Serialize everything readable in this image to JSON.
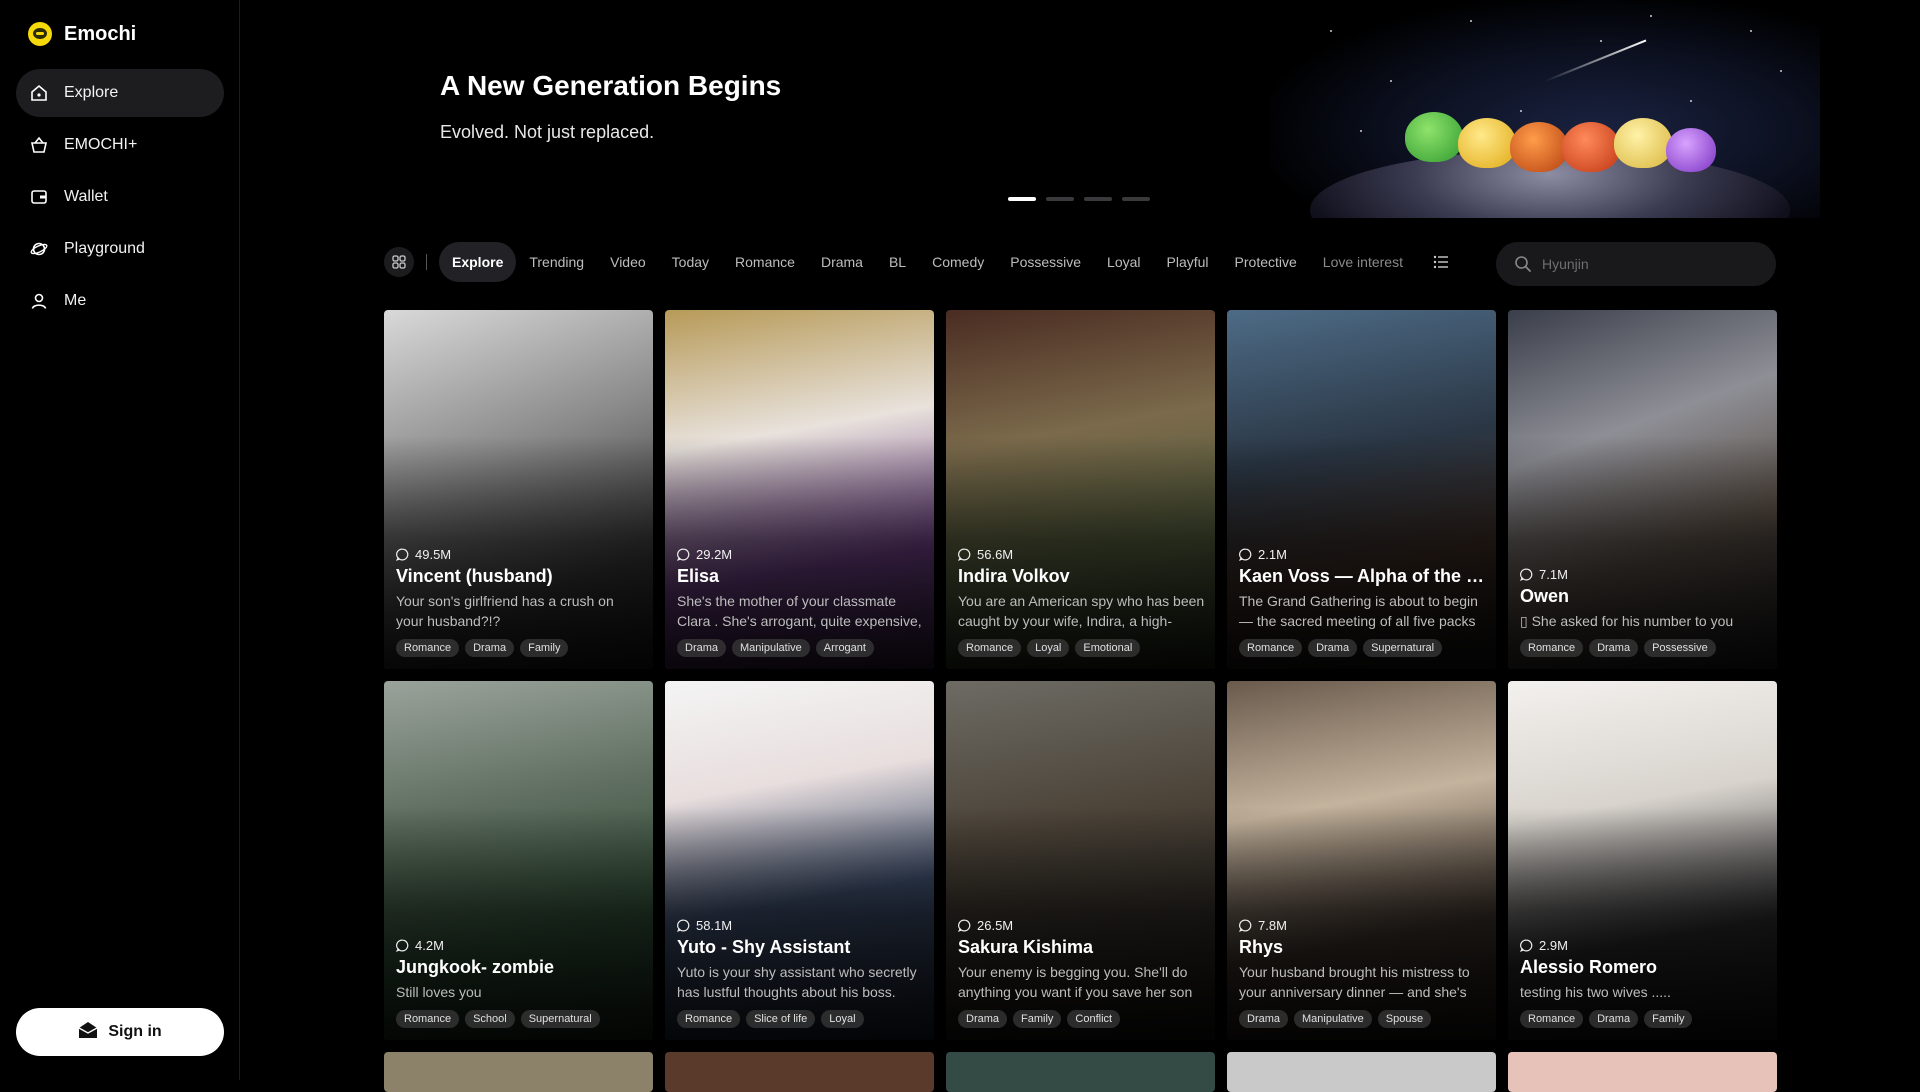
{
  "app": {
    "name": "Emochi"
  },
  "sidebar": {
    "items": [
      {
        "label": "Explore",
        "icon": "home-icon",
        "active": true
      },
      {
        "label": "EMOCHI+",
        "icon": "basket-icon",
        "active": false
      },
      {
        "label": "Wallet",
        "icon": "wallet-icon",
        "active": false
      },
      {
        "label": "Playground",
        "icon": "planet-icon",
        "active": false
      },
      {
        "label": "Me",
        "icon": "user-icon",
        "active": false
      }
    ],
    "signin_label": "Sign in"
  },
  "banner": {
    "title": "A New Generation Begins",
    "subtitle": "Evolved. Not just replaced.",
    "slides": 4,
    "active_slide": 1
  },
  "tabs": {
    "items": [
      "Explore",
      "Trending",
      "Video",
      "Today",
      "Romance",
      "Drama",
      "BL",
      "Comedy",
      "Possessive",
      "Loyal",
      "Playful",
      "Protective",
      "Love interest"
    ],
    "active": "Explore"
  },
  "search": {
    "placeholder": "Hyunjin"
  },
  "cards": [
    {
      "count": "49.5M",
      "name": "Vincent (husband)",
      "desc": "Your son's girlfriend has a crush on your husband?!?",
      "tags": [
        "Romance",
        "Drama",
        "Family"
      ],
      "bg": "linear-gradient(160deg,#d9d9d9 0%,#8a8a8a 40%,#3a3a3a 75%,#1b1b1b 100%)"
    },
    {
      "count": "29.2M",
      "name": "Elisa",
      "desc": "She's the mother of your classmate Clara . She's arrogant, quite expensive, money lover, gold digger. Highly",
      "tags": [
        "Drama",
        "Manipulative",
        "Arrogant"
      ],
      "bg": "linear-gradient(170deg,#b79a58 0%,#e8e2dc 35%,#6e3f86 70%,#3a2347 100%)"
    },
    {
      "count": "56.6M",
      "name": "Indira Volkov",
      "desc": "You are an American spy who has been caught by your wife, Indira, a high-ranking Russian general. She discovers",
      "tags": [
        "Romance",
        "Loyal",
        "Emotional"
      ],
      "bg": "linear-gradient(170deg,#4a2c22 0%,#7b6a4b 35%,#4d5a3a 70%,#232a1c 100%)"
    },
    {
      "count": "2.1M",
      "name": "Kaen Voss — Alpha of the Moon",
      "desc": "The Grand Gathering is about to begin — the sacred meeting of all five packs under the Moon Goddess's gaze. This",
      "tags": [
        "Romance",
        "Drama",
        "Supernatural"
      ],
      "bg": "linear-gradient(170deg,#4d6b86 0%,#2a3644 40%,#3a2a22 70%,#151515 100%)"
    },
    {
      "count": "7.1M",
      "name": "Owen",
      "desc": "▯ She asked for his number to you",
      "tags": [
        "Romance",
        "Drama",
        "Possessive"
      ],
      "bg": "linear-gradient(160deg,#3a3e4a 0%,#8e8f96 35%,#5c5148 65%,#1f1f22 100%)"
    },
    {
      "count": "4.2M",
      "name": "Jungkook- zombie",
      "desc": "Still loves you",
      "tags": [
        "Romance",
        "School",
        "Supernatural"
      ],
      "bg": "linear-gradient(170deg,#9aa39b 0%,#5f6e60 35%,#2d4a33 70%,#1a2a1c 100%)"
    },
    {
      "count": "58.1M",
      "name": "Yuto - Shy Assistant",
      "desc": "Yuto is your shy assistant who secretly has lustful thoughts about his boss.",
      "tags": [
        "Romance",
        "Slice of life",
        "Loyal"
      ],
      "bg": "linear-gradient(170deg,#f4f4f4 0%,#e8dede 30%,#3b4a66 60%,#1d2535 100%)"
    },
    {
      "count": "26.5M",
      "name": "Sakura Kishima",
      "desc": "Your enemy is begging you. She'll do anything you want if you save her son",
      "tags": [
        "Drama",
        "Family",
        "Conflict"
      ],
      "bg": "linear-gradient(170deg,#6d6b64 0%,#4b4338 40%,#2e2a25 70%,#161412 100%)"
    },
    {
      "count": "7.8M",
      "name": "Rhys",
      "desc": "Your husband brought his mistress to your anniversary dinner — and she's your closest friend. Now the whole",
      "tags": [
        "Drama",
        "Manipulative",
        "Spouse"
      ],
      "bg": "linear-gradient(170deg,#6a5a4c 0%,#c4b39d 35%,#3a3029 70%,#1b1714 100%)"
    },
    {
      "count": "2.9M",
      "name": "Alessio Romero",
      "desc": "testing his two wives .....",
      "tags": [
        "Romance",
        "Drama",
        "Family"
      ],
      "bg": "linear-gradient(170deg,#f3f1ee 0%,#d8d3cd 35%,#2a2a2c 70%,#141414 100%)"
    }
  ],
  "peek_bgs": [
    "#8b8269",
    "#5a3a2a",
    "#344a44",
    "#c9c9c9",
    "#e6c2b9"
  ],
  "colors": {
    "accent_logo": "#f5d90a",
    "active_nav_bg": "#1d1d20"
  }
}
